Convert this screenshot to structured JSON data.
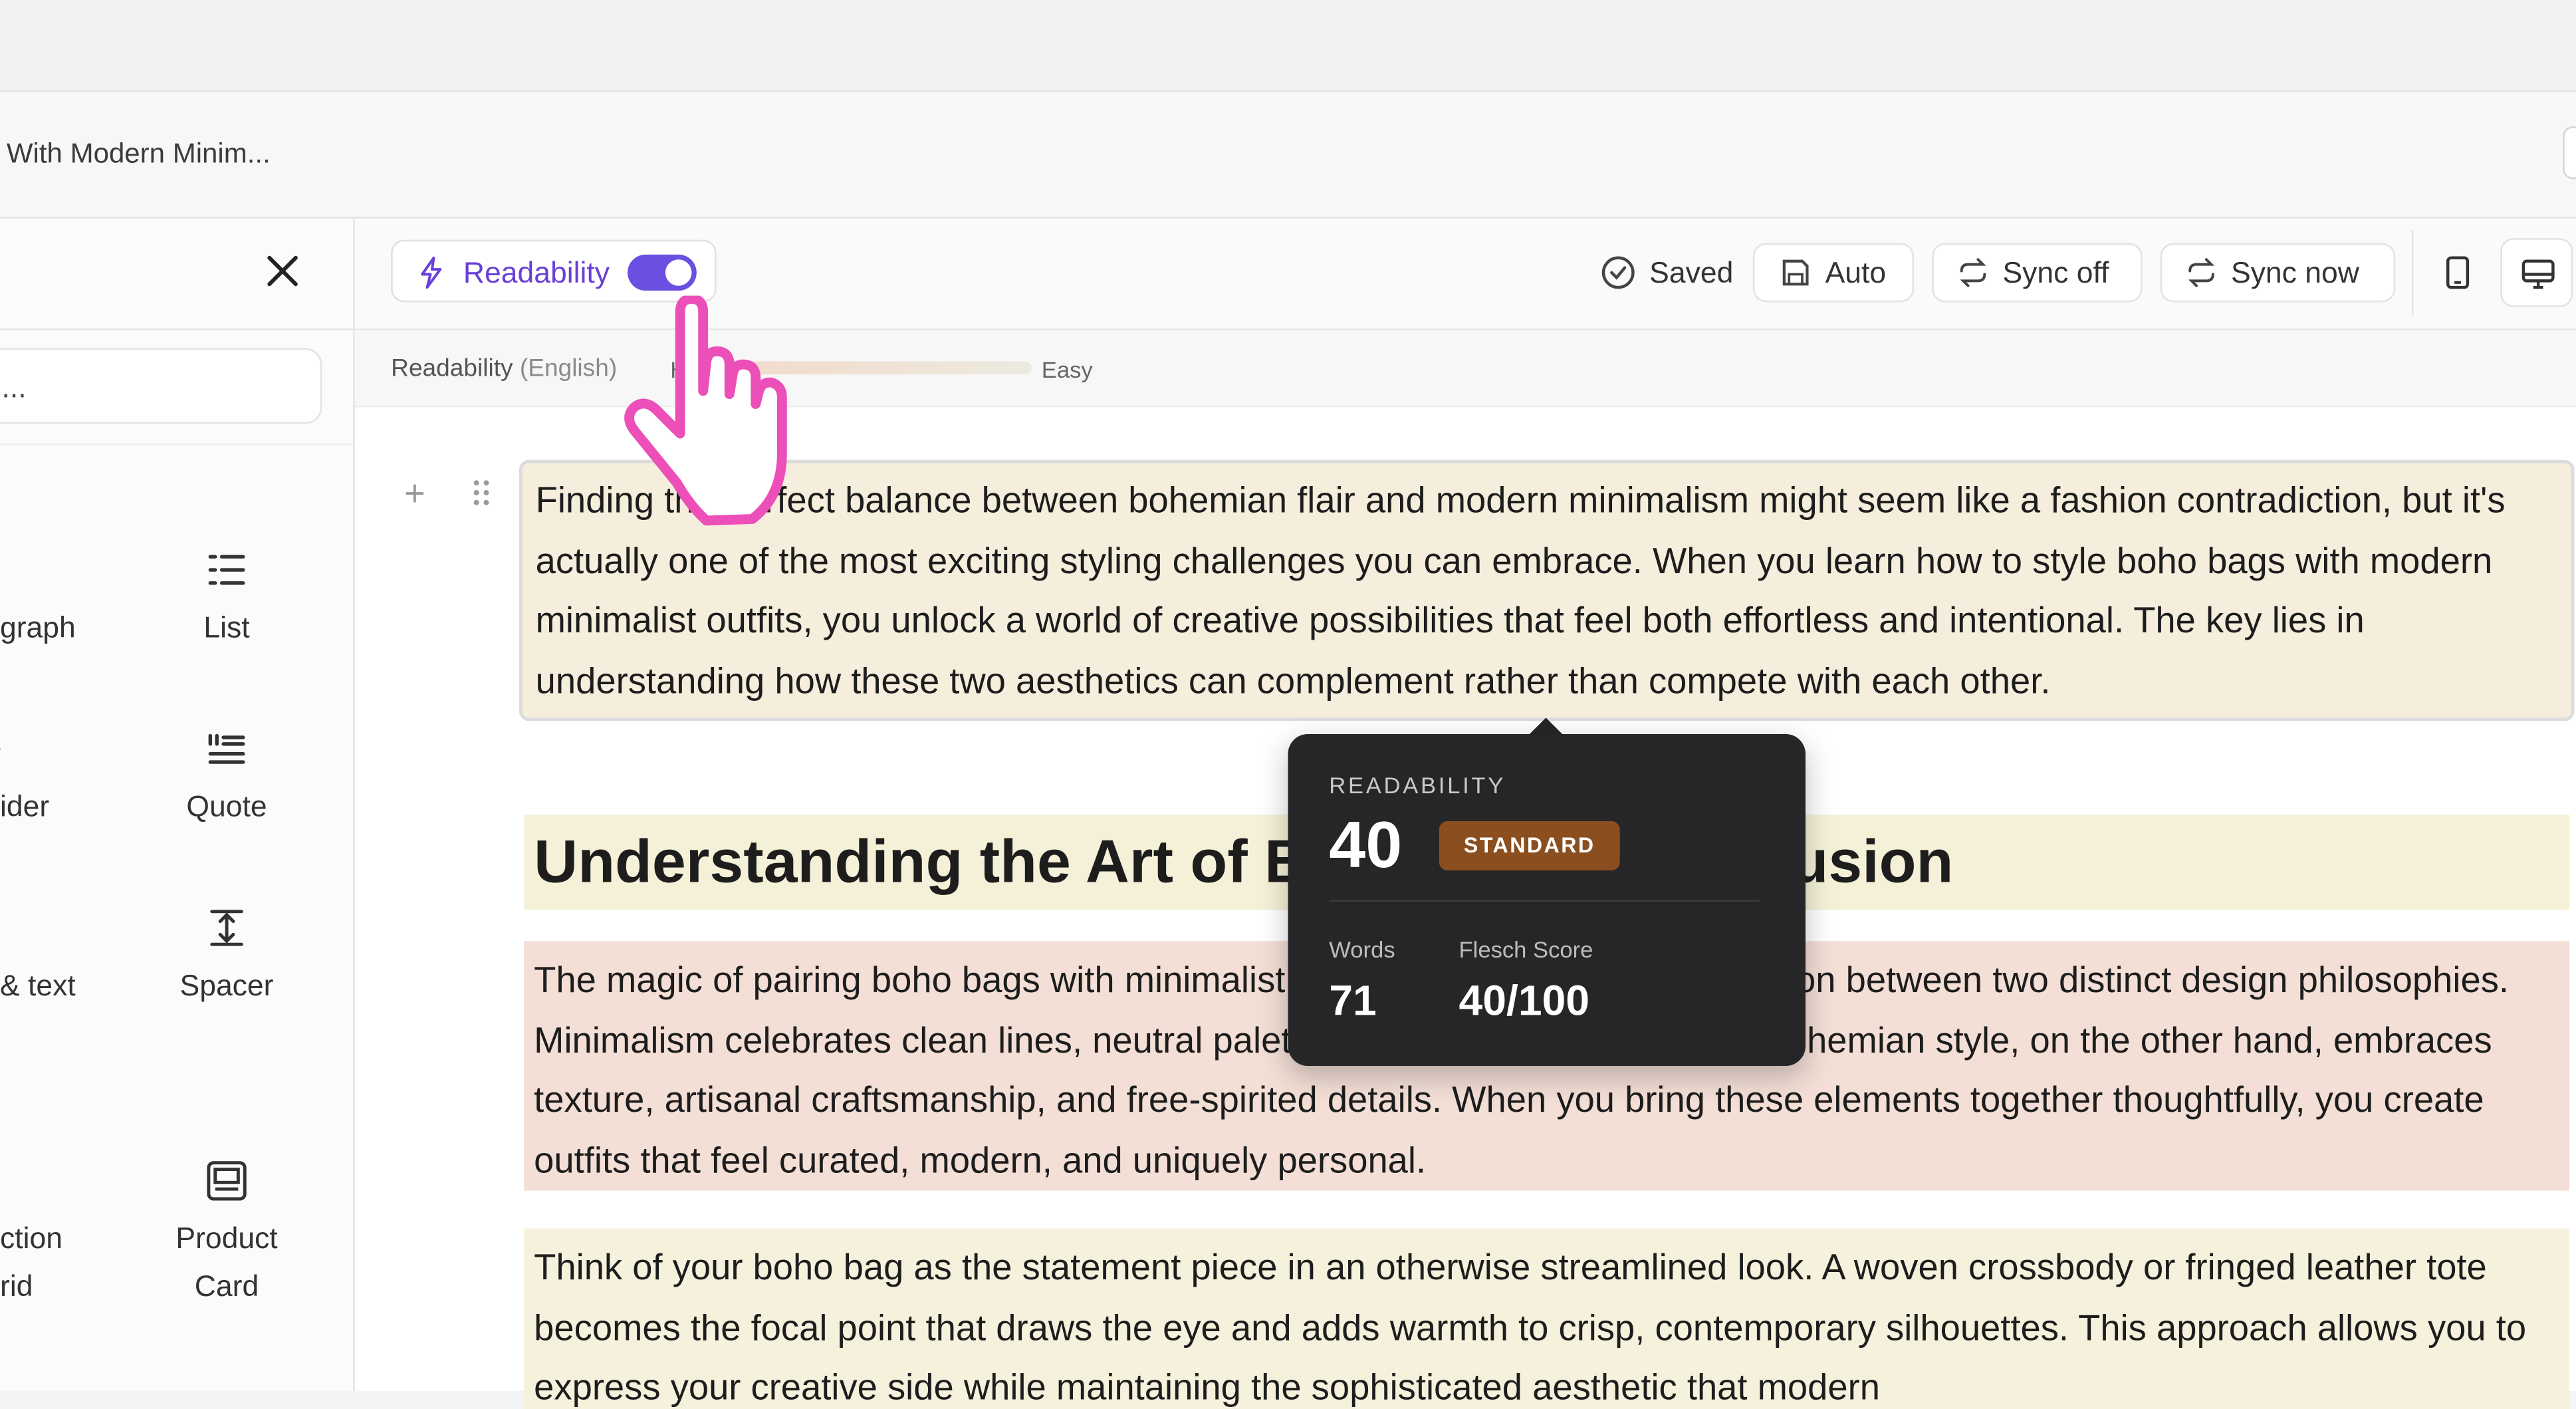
{
  "document": {
    "title": "With Modern Minim..."
  },
  "blocks_panel": {
    "search_placeholder": "...",
    "items": [
      {
        "label": "graph",
        "icon": "paragraph-icon"
      },
      {
        "label": "List",
        "icon": "list-icon"
      },
      {
        "label": "ider",
        "icon": "divider-icon"
      },
      {
        "label": "Quote",
        "icon": "quote-icon"
      },
      {
        "label": "& text",
        "icon": "image-text-icon"
      },
      {
        "label": "Spacer",
        "icon": "spacer-icon"
      },
      {
        "label": "ction",
        "label2": "rid",
        "icon": "collection-grid-icon"
      },
      {
        "label": "Product",
        "label2": "Card",
        "icon": "product-card-icon"
      }
    ]
  },
  "toolbar": {
    "readability_label": "Readability",
    "readability_on": true,
    "saved_label": "Saved",
    "auto_label": "Auto",
    "sync_off_label": "Sync off",
    "sync_now_label": "Sync now"
  },
  "readability_bar": {
    "label": "Readability",
    "language": "(English)",
    "hard_label": "H",
    "easy_label": "Easy"
  },
  "content": {
    "p1": "Finding the perfect balance between bohemian flair and modern minimalism might seem like a fashion contradiction, but it's actually one of the most exciting styling challenges you can embrace. When you learn how to style boho bags with modern minimalist outfits, you unlock a world of creative possibilities that feel both effortless and intentional. The key lies in understanding how these two aesthetics can complement rather than compete with each other.",
    "h2": "Understanding the Art of Boho-Minimalist Fusion",
    "p2": "The magic of pairing boho bags with minimalist pieces lies in the beautiful tension between two distinct design philosophies. Minimalism celebrates clean lines, neutral palettes, and thoughtful simplicity. Bohemian style, on the other hand, embraces texture, artisanal craftsmanship, and free-spirited details. When you bring these elements together thoughtfully, you create outfits that feel curated, modern, and uniquely personal.",
    "p3": "Think of your boho bag as the statement piece in an otherwise streamlined look. A woven crossbody or fringed leather tote becomes the focal point that draws the eye and adds warmth to crisp, contemporary silhouettes. This approach allows you to express your creative side while maintaining the sophisticated aesthetic that modern"
  },
  "tooltip": {
    "heading": "READABILITY",
    "score": "40",
    "badge": "STANDARD",
    "words_label": "Words",
    "words_value": "71",
    "flesch_label": "Flesch Score",
    "flesch_value": "40/100"
  },
  "colors": {
    "accent": "#6a4fe0",
    "badge": "#8a4e1f",
    "cursor": "#ec4fb8",
    "para_hard": "#f3dfd6",
    "para_medium": "#f6eedd"
  }
}
